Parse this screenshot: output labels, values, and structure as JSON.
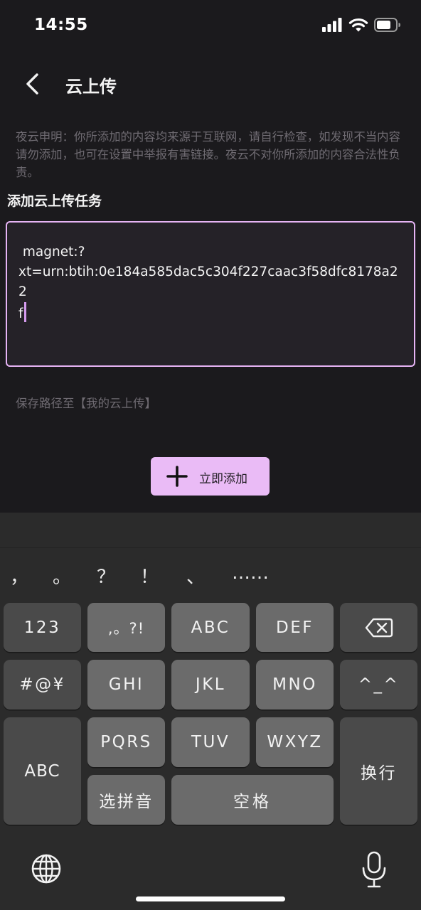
{
  "status_bar": {
    "time": "14:55"
  },
  "header": {
    "title": "云上传"
  },
  "disclaimer": "夜云申明：你所添加的内容均来源于互联网，请自行检查，如发现不当内容请勿添加，也可在设置中举报有害链接。夜云不对你所添加的内容合法性负责。",
  "section_title": "添加云上传任务",
  "task_input": {
    "value": " magnet:?\nxt=urn:btih:0e184a585dac5c304f227caac3f58dfc8178a22\nf"
  },
  "save_path": "保存路径至【我的云上传】",
  "add_button": {
    "label": "立即添加"
  },
  "keyboard": {
    "punctuation": [
      "，",
      "。",
      "？",
      "！",
      "、",
      "……"
    ],
    "keys": {
      "numbers": "123",
      "punct": ",。?!",
      "abc_key": "ABC",
      "def_key": "DEF",
      "symbols": "#@¥",
      "ghi_key": "GHI",
      "jkl_key": "JKL",
      "mno_key": "MNO",
      "emoticon": "^_^",
      "abc_switch": "ABC",
      "pqrs_key": "PQRS",
      "tuv_key": "TUV",
      "wxyz_key": "WXYZ",
      "return": "换行",
      "pinyin": "选拼音",
      "space": "空格"
    }
  },
  "colors": {
    "background": "#1b1a1d",
    "accent": "#eabbf6",
    "input_border": "#e6b4f5",
    "muted_text": "#6f6b72",
    "keyboard_bg": "#2b2b2b"
  },
  "icons": [
    "back-chevron-icon",
    "signal-icon",
    "wifi-icon",
    "battery-icon",
    "plus-icon",
    "backspace-icon",
    "globe-icon",
    "microphone-icon"
  ]
}
